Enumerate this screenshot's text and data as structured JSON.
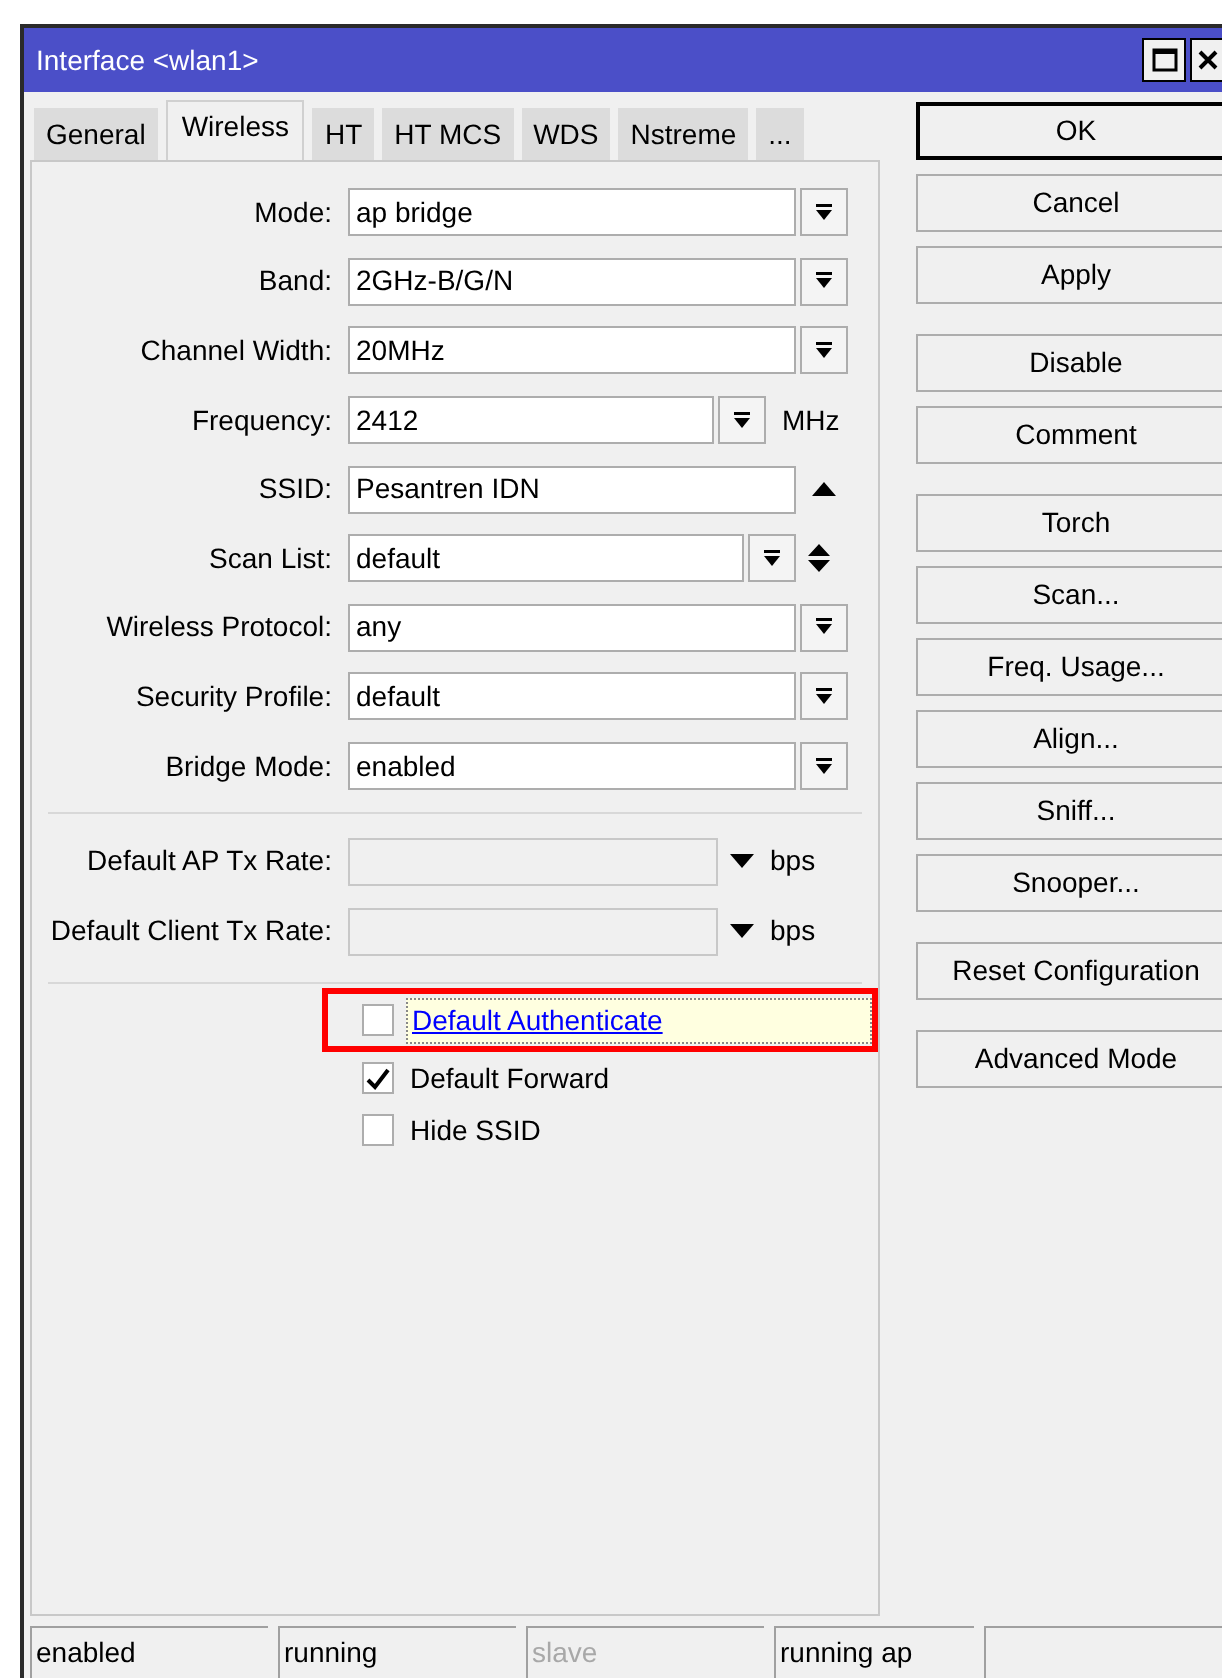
{
  "window": {
    "title": "Interface <wlan1>"
  },
  "tabs": [
    {
      "label": "General",
      "selected": false
    },
    {
      "label": "Wireless",
      "selected": true
    },
    {
      "label": "HT",
      "selected": false
    },
    {
      "label": "HT MCS",
      "selected": false
    },
    {
      "label": "WDS",
      "selected": false
    },
    {
      "label": "Nstreme",
      "selected": false
    },
    {
      "label": "...",
      "selected": false
    }
  ],
  "fields": [
    {
      "label": "Mode:",
      "value": "ap bridge",
      "kind": "select"
    },
    {
      "label": "Band:",
      "value": "2GHz-B/G/N",
      "kind": "select"
    },
    {
      "label": "Channel Width:",
      "value": "20MHz",
      "kind": "select"
    },
    {
      "label": "Frequency:",
      "value": "2412",
      "kind": "unit",
      "unit": "MHz"
    },
    {
      "label": "SSID:",
      "value": "Pesantren IDN",
      "kind": "combo"
    },
    {
      "label": "Scan List:",
      "value": "default",
      "kind": "scan"
    },
    {
      "label": "Wireless Protocol:",
      "value": "any",
      "kind": "select"
    },
    {
      "label": "Security Profile:",
      "value": "default",
      "kind": "select"
    },
    {
      "label": "Bridge Mode:",
      "value": "enabled",
      "kind": "select"
    }
  ],
  "rates": [
    {
      "label": "Default AP Tx Rate:",
      "unit": "bps"
    },
    {
      "label": "Default Client Tx Rate:",
      "unit": "bps"
    }
  ],
  "checkboxes": [
    {
      "label": "Default Authenticate",
      "checked": false,
      "focused": true,
      "highlighted": true
    },
    {
      "label": "Default Forward",
      "checked": true,
      "focused": false,
      "highlighted": false
    },
    {
      "label": "Hide SSID",
      "checked": false,
      "focused": false,
      "highlighted": false
    }
  ],
  "button_groups": [
    [
      {
        "label": "OK",
        "default": true
      },
      {
        "label": "Cancel",
        "default": false
      },
      {
        "label": "Apply",
        "default": false
      }
    ],
    [
      {
        "label": "Disable",
        "default": false
      },
      {
        "label": "Comment",
        "default": false
      }
    ],
    [
      {
        "label": "Torch",
        "default": false
      },
      {
        "label": "Scan...",
        "default": false
      },
      {
        "label": "Freq. Usage...",
        "default": false
      },
      {
        "label": "Align...",
        "default": false
      },
      {
        "label": "Sniff...",
        "default": false
      },
      {
        "label": "Snooper...",
        "default": false
      }
    ],
    [
      {
        "label": "Reset Configuration",
        "default": false
      }
    ],
    [
      {
        "label": "Advanced Mode",
        "default": false
      }
    ]
  ],
  "status_bar": [
    {
      "text": "enabled",
      "disabled": false
    },
    {
      "text": "running",
      "disabled": false
    },
    {
      "text": "slave",
      "disabled": true
    },
    {
      "text": "running ap",
      "disabled": false
    }
  ]
}
